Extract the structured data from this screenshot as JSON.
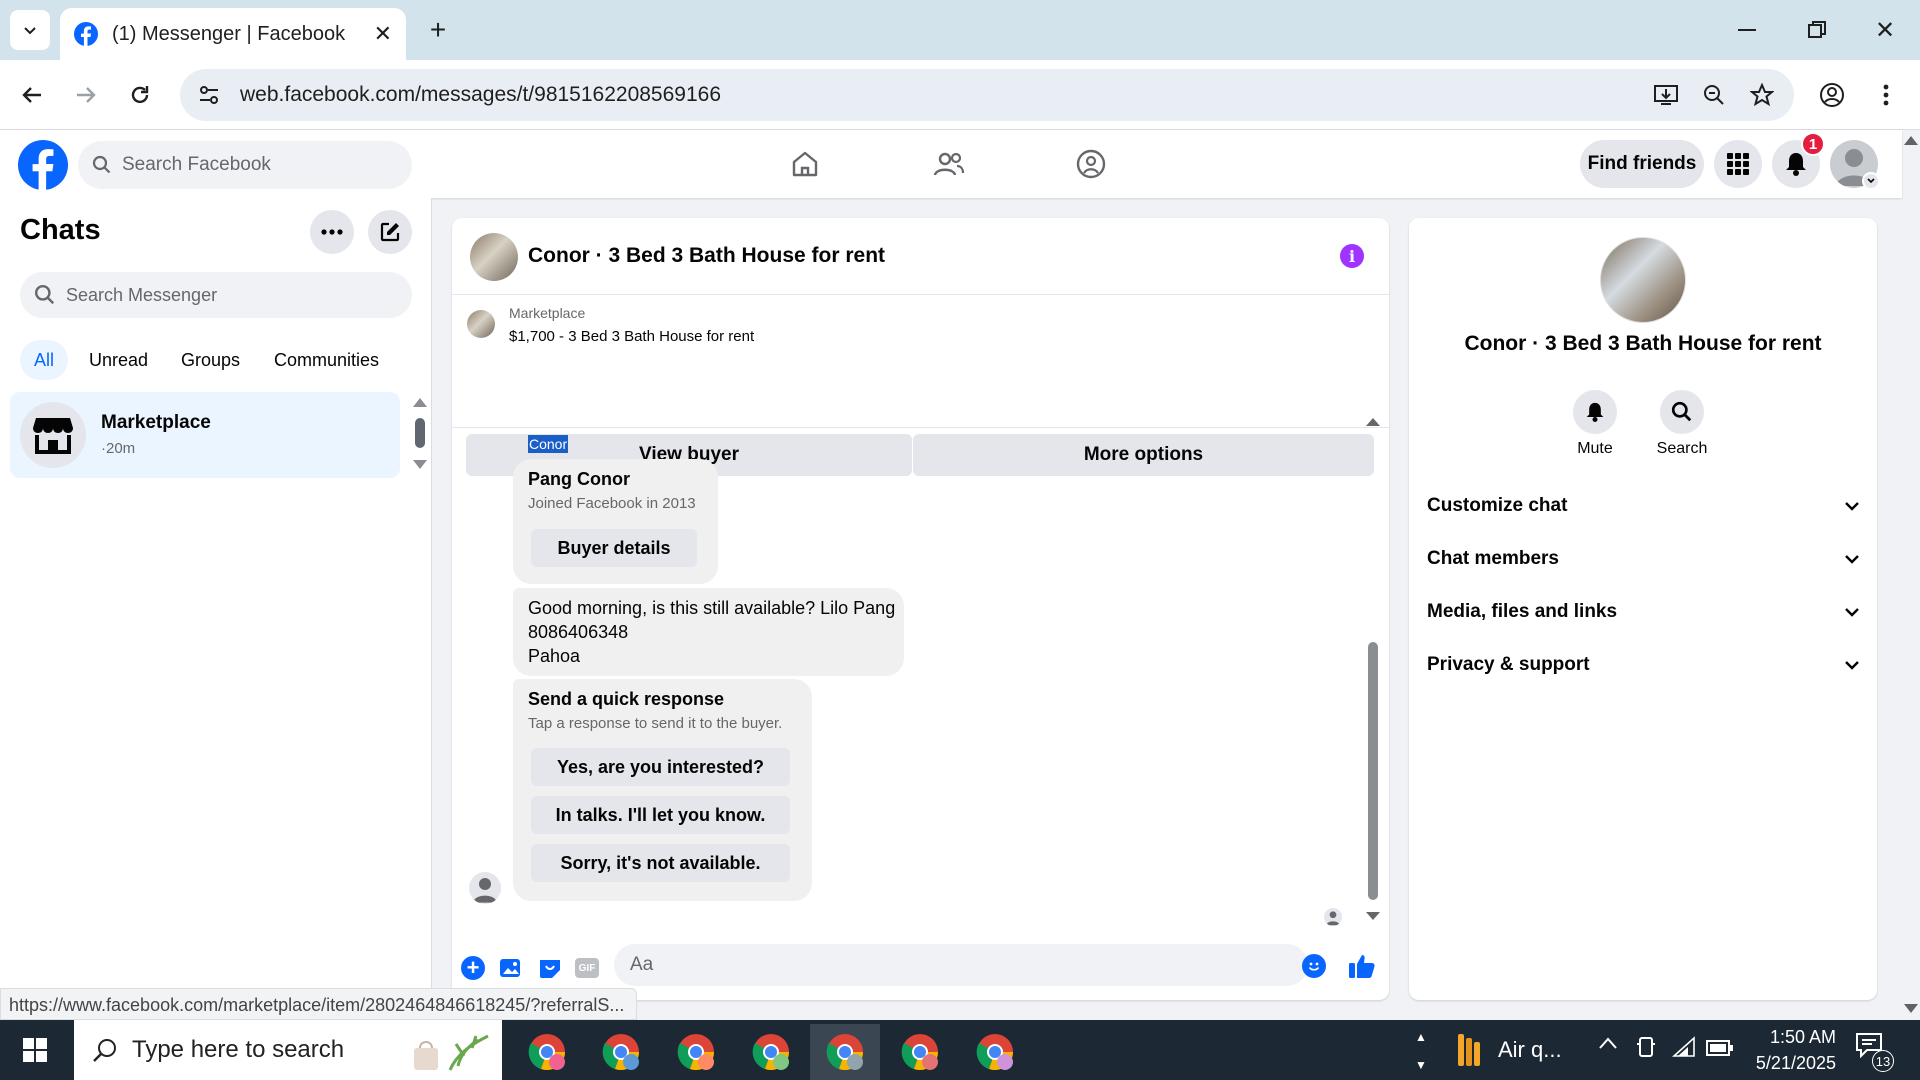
{
  "browser": {
    "tab_title": "(1) Messenger | Facebook",
    "url": "web.facebook.com/messages/t/9815162208569166",
    "status_url": "https://www.facebook.com/marketplace/item/2802464846618245/?referralS..."
  },
  "fb": {
    "search_placeholder": "Search Facebook",
    "find_friends": "Find friends",
    "notification_count": "1"
  },
  "chats": {
    "title": "Chats",
    "search_placeholder": "Search Messenger",
    "filters": [
      "All",
      "Unread",
      "Groups",
      "Communities"
    ],
    "items": [
      {
        "name": "Marketplace",
        "time": "·20m"
      }
    ]
  },
  "conversation": {
    "title": "Conor · 3 Bed 3 Bath House for rent",
    "listing_source": "Marketplace",
    "listing_text": "$1,700 - 3 Bed 3 Bath House for rent",
    "view_buyer": "View buyer",
    "more_options": "More options",
    "highlighted_name": "Conor",
    "buyer_name": "Pang Conor",
    "buyer_joined": "Joined Facebook in 2013",
    "buyer_details": "Buyer details",
    "message_lines": [
      "Good morning, is this still available? Lilo Pang",
      "8086406348",
      "Pahoa"
    ],
    "quick_title": "Send a quick response",
    "quick_subtitle": "Tap a response to send it to the buyer.",
    "quick_responses": [
      "Yes, are you interested?",
      "In talks. I'll let you know.",
      "Sorry, it's not available."
    ],
    "composer_placeholder": "Aa",
    "gif_label": "GIF"
  },
  "info_panel": {
    "title": "Conor · 3 Bed 3 Bath House for rent",
    "mute": "Mute",
    "search": "Search",
    "sections": [
      "Customize chat",
      "Chat members",
      "Media, files and links",
      "Privacy & support"
    ]
  },
  "taskbar": {
    "search_placeholder": "Type here to search",
    "weather": "Air q...",
    "time": "1:50 AM",
    "date": "5/21/2025",
    "notification_count": "13"
  },
  "colors": {
    "fb_blue": "#0866ff",
    "messenger_purple": "#a033ff",
    "selected_chat_bg": "#ebf5ff"
  }
}
